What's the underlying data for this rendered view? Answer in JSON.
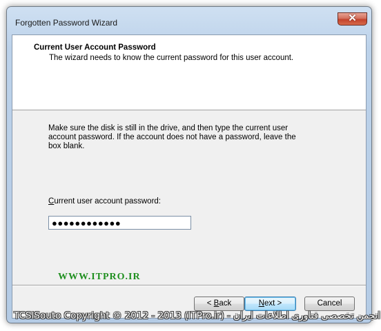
{
  "window": {
    "title": "Forgotten Password Wizard",
    "close_glyph": "✕"
  },
  "header": {
    "title": "Current User Account Password",
    "subtitle": "The wizard needs to know the current password for this user account."
  },
  "body": {
    "instructions": "Make sure the disk is still in the drive, and then type the current user account password. If the account does not have a password, leave the box blank.",
    "password_label": "Current user account password:",
    "password_value": "●●●●●●●●●●●●"
  },
  "watermark": "WWW.ITPRO.IR",
  "buttons": {
    "back_prefix": "< ",
    "back_mnemonic": "B",
    "back_rest": "ack",
    "next_mnemonic": "N",
    "next_rest": "ext >",
    "cancel": "Cancel"
  },
  "footer": "TCSISouto Copyright © 2012 - 2013 (ITPro.ir) - انجمن تخصصی فناوری اطلاعات ایران"
}
